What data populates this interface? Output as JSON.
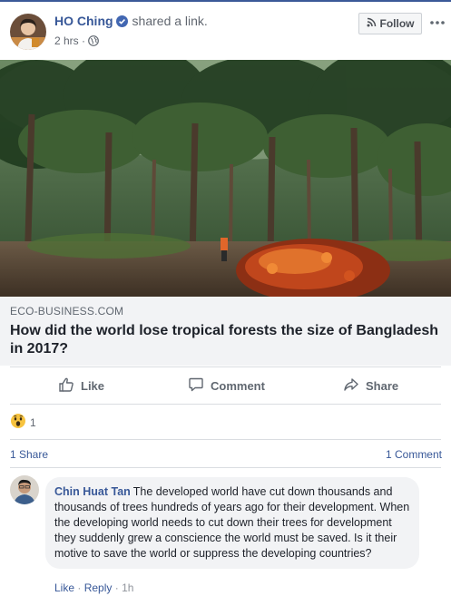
{
  "post": {
    "author": "HO Ching",
    "action": "shared a link.",
    "time": "2 hrs",
    "dot": "·",
    "follow_label": "Follow"
  },
  "link": {
    "domain": "ECO-BUSINESS.COM",
    "title": "How did the world lose tropical forests the size of Bangladesh in 2017?"
  },
  "actions": {
    "like": "Like",
    "comment": "Comment",
    "share": "Share"
  },
  "stats": {
    "reaction_count": "1",
    "shares": "1 Share",
    "comments": "1 Comment"
  },
  "comment": {
    "author": "Chin Huat Tan",
    "text": "The developed world have cut down thousands and thousands of trees hundreds of years ago for their development. When the developing world needs to cut down their trees for development they suddenly grew a conscience the world must be saved. Is it their motive to save the world or suppress the developing countries?",
    "like": "Like",
    "reply": "Reply",
    "sep": "·",
    "time": "1h"
  },
  "colors": {
    "brand": "#3b5998",
    "link": "#385898",
    "muted": "#606770",
    "caption_bg": "#f2f3f5"
  },
  "icons": [
    "verified-badge-icon",
    "globe-icon",
    "rss-icon",
    "more-icon",
    "thumbs-up-icon",
    "comment-icon",
    "share-arrow-icon",
    "wow-emoji-icon"
  ]
}
